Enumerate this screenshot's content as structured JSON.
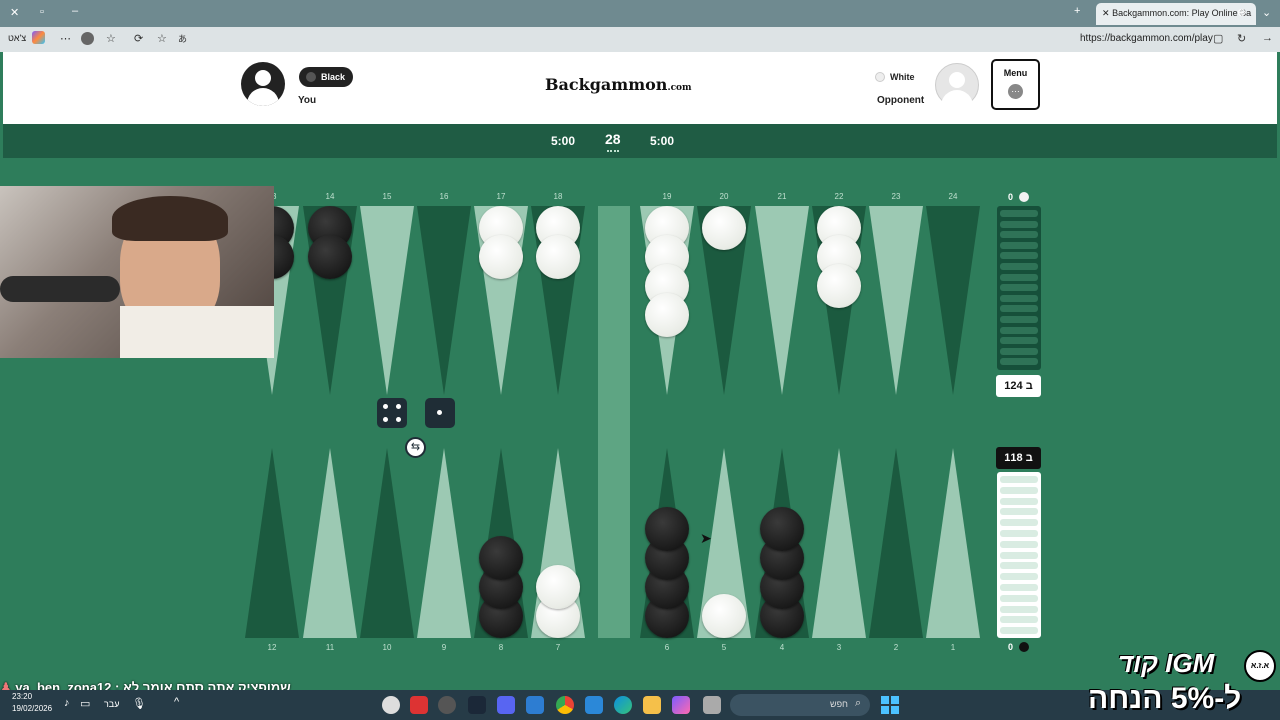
{
  "browser": {
    "tab_title": "Backgammon.com: Play Online Ba",
    "url": "https://backgammon.com/play",
    "profile_label": "צ'אט"
  },
  "header": {
    "logo_main": "Backgammon",
    "logo_suffix": ".com",
    "player": {
      "color_label": "Black",
      "name": "You"
    },
    "opponent": {
      "color_label": "White",
      "name": "Opponent"
    },
    "menu_label": "Menu"
  },
  "timers": {
    "left": "5:00",
    "center": "28",
    "right": "5:00"
  },
  "board": {
    "top_points": [
      "13",
      "14",
      "15",
      "16",
      "17",
      "18",
      "19",
      "20",
      "21",
      "22",
      "23",
      "24"
    ],
    "bottom_points": [
      "12",
      "11",
      "10",
      "9",
      "8",
      "7",
      "6",
      "5",
      "4",
      "3",
      "2",
      "1"
    ],
    "top_tray_count": "0",
    "bottom_tray_count": "0",
    "opponent_pips": "124",
    "player_pips": "118",
    "pip_prefix": "ב",
    "dice": [
      4,
      1
    ]
  },
  "stream": {
    "chat_message": "ya_ben_zona12 : שמופציק אתה סתם אומר לא",
    "promo_line1": "קוד IGM",
    "promo_line2": "ל-5% הנחה",
    "promo_badge": "א.ז.א"
  },
  "taskbar": {
    "time": "23:20",
    "date": "19/02/2026",
    "lang": "עבר",
    "search_placeholder": "חפש"
  },
  "colors": {
    "felt": "#2e7d5b",
    "dark_point": "#1b5a3f",
    "light_point": "#9cc9b3",
    "header_bar": "#1f5c44"
  }
}
